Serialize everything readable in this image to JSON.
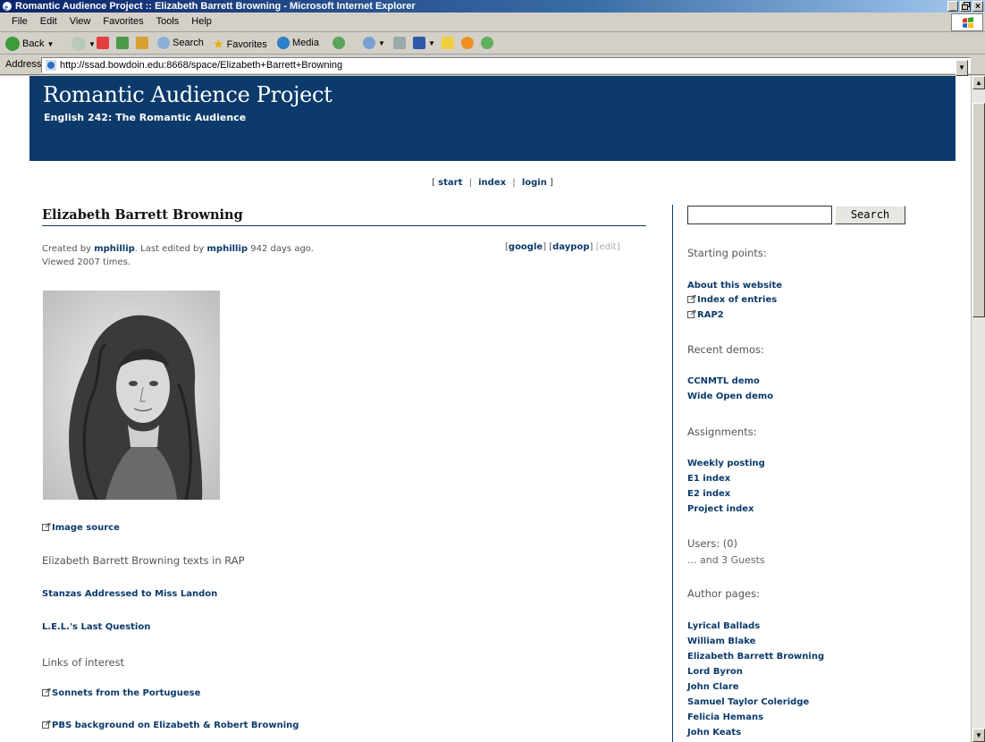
{
  "window": {
    "title": "Romantic Audience Project :: Elizabeth Barrett Browning - Microsoft Internet Explorer",
    "controls": [
      "_",
      "🗗",
      "×"
    ]
  },
  "menu": [
    "File",
    "Edit",
    "View",
    "Favorites",
    "Tools",
    "Help"
  ],
  "toolbar": {
    "back": "Back",
    "search": "Search",
    "favorites": "Favorites",
    "media": "Media"
  },
  "address": {
    "label": "Address",
    "url": "http://ssad.bowdoin.edu:8668/space/Elizabeth+Barrett+Browning"
  },
  "site": {
    "title": "Romantic Audience Project",
    "subtitle": "English 242: The Romantic Audience"
  },
  "topnav": {
    "open": "[",
    "start": "start",
    "index": "index",
    "login": "login",
    "close": "]",
    "sep": "|"
  },
  "page": {
    "title": "Elizabeth Barrett Browning",
    "meta": {
      "created_by_prefix": "Created by",
      "creator": "mphillip",
      "edited_prefix": ". Last edited by",
      "editor": "mphillip",
      "edited_suffix": "942 days ago. Viewed 2007 times."
    },
    "ext_links": {
      "google": "google",
      "daypop": "daypop",
      "edit": "edit"
    },
    "image_source": "Image source",
    "texts_heading": "Elizabeth Barrett Browning texts in RAP",
    "texts": [
      "Stanzas Addressed to Miss Landon",
      "L.E.L.'s Last Question"
    ],
    "links_heading": "Links of interest",
    "links": [
      "Sonnets from the Portuguese",
      "PBS background on Elizabeth & Robert Browning"
    ]
  },
  "sidebar": {
    "search_button": "Search",
    "search_value": "",
    "starting_heading": "Starting points:",
    "starting": [
      "About this website",
      "Index of entries",
      "RAP2"
    ],
    "demos_heading": "Recent demos:",
    "demos": [
      "CCNMTL demo",
      "Wide Open demo"
    ],
    "assignments_heading": "Assignments:",
    "assignments": [
      "Weekly posting",
      "E1 index",
      "E2 index",
      "Project index"
    ],
    "users_heading": "Users: (0)",
    "guests": "... and 3 Guests",
    "authors_heading": "Author pages:",
    "authors": [
      "Lyrical Ballads",
      "William Blake",
      "Elizabeth Barrett Browning",
      "Lord Byron",
      "John Clare",
      "Samuel Taylor Coleridge",
      "Felicia Hemans",
      "John Keats"
    ]
  },
  "colors": {
    "banner": "#0b3a6b",
    "link": "#0b3a6b",
    "titlebar": "#0a246a"
  }
}
